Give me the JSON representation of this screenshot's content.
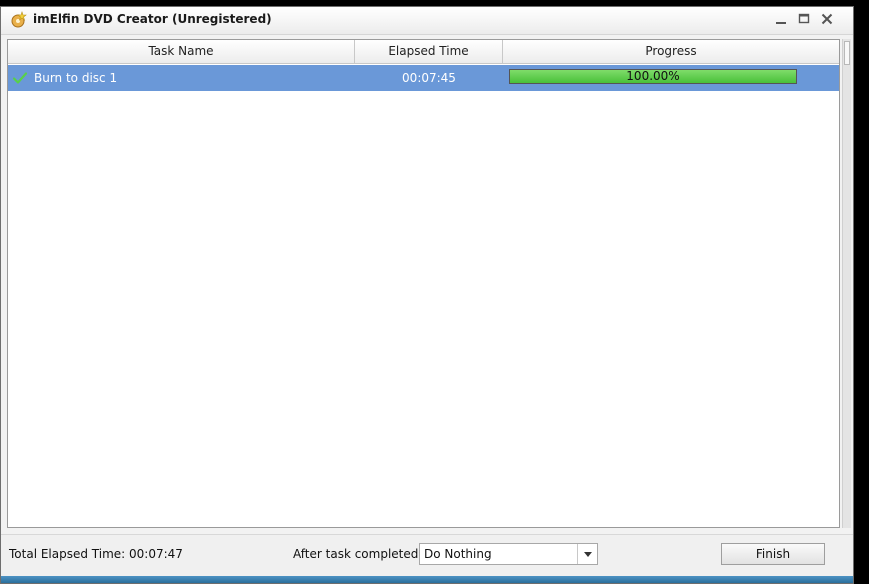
{
  "window": {
    "title": "imElfin DVD Creator (Unregistered)",
    "icon": "app-icon",
    "controls": [
      "minimize-icon",
      "maximize-icon",
      "close-icon"
    ]
  },
  "table": {
    "columns": [
      "Task Name",
      "Elapsed Time",
      "Progress"
    ],
    "rows": [
      {
        "status_icon": "check-icon",
        "task_name": "Burn to disc 1",
        "elapsed_time": "00:07:45",
        "progress_label": "100.00%",
        "progress_fraction": 1.0,
        "selected": true
      }
    ]
  },
  "footer": {
    "total_elapsed": "Total Elapsed Time: 00:07:47",
    "after_task_label": "After task completed:",
    "after_task_value": "Do Nothing",
    "finish_label": "Finish"
  },
  "colors": {
    "selection": "#6a98d8",
    "progress_fill": "#49c13a",
    "accent_strip": "#3a82b4"
  }
}
